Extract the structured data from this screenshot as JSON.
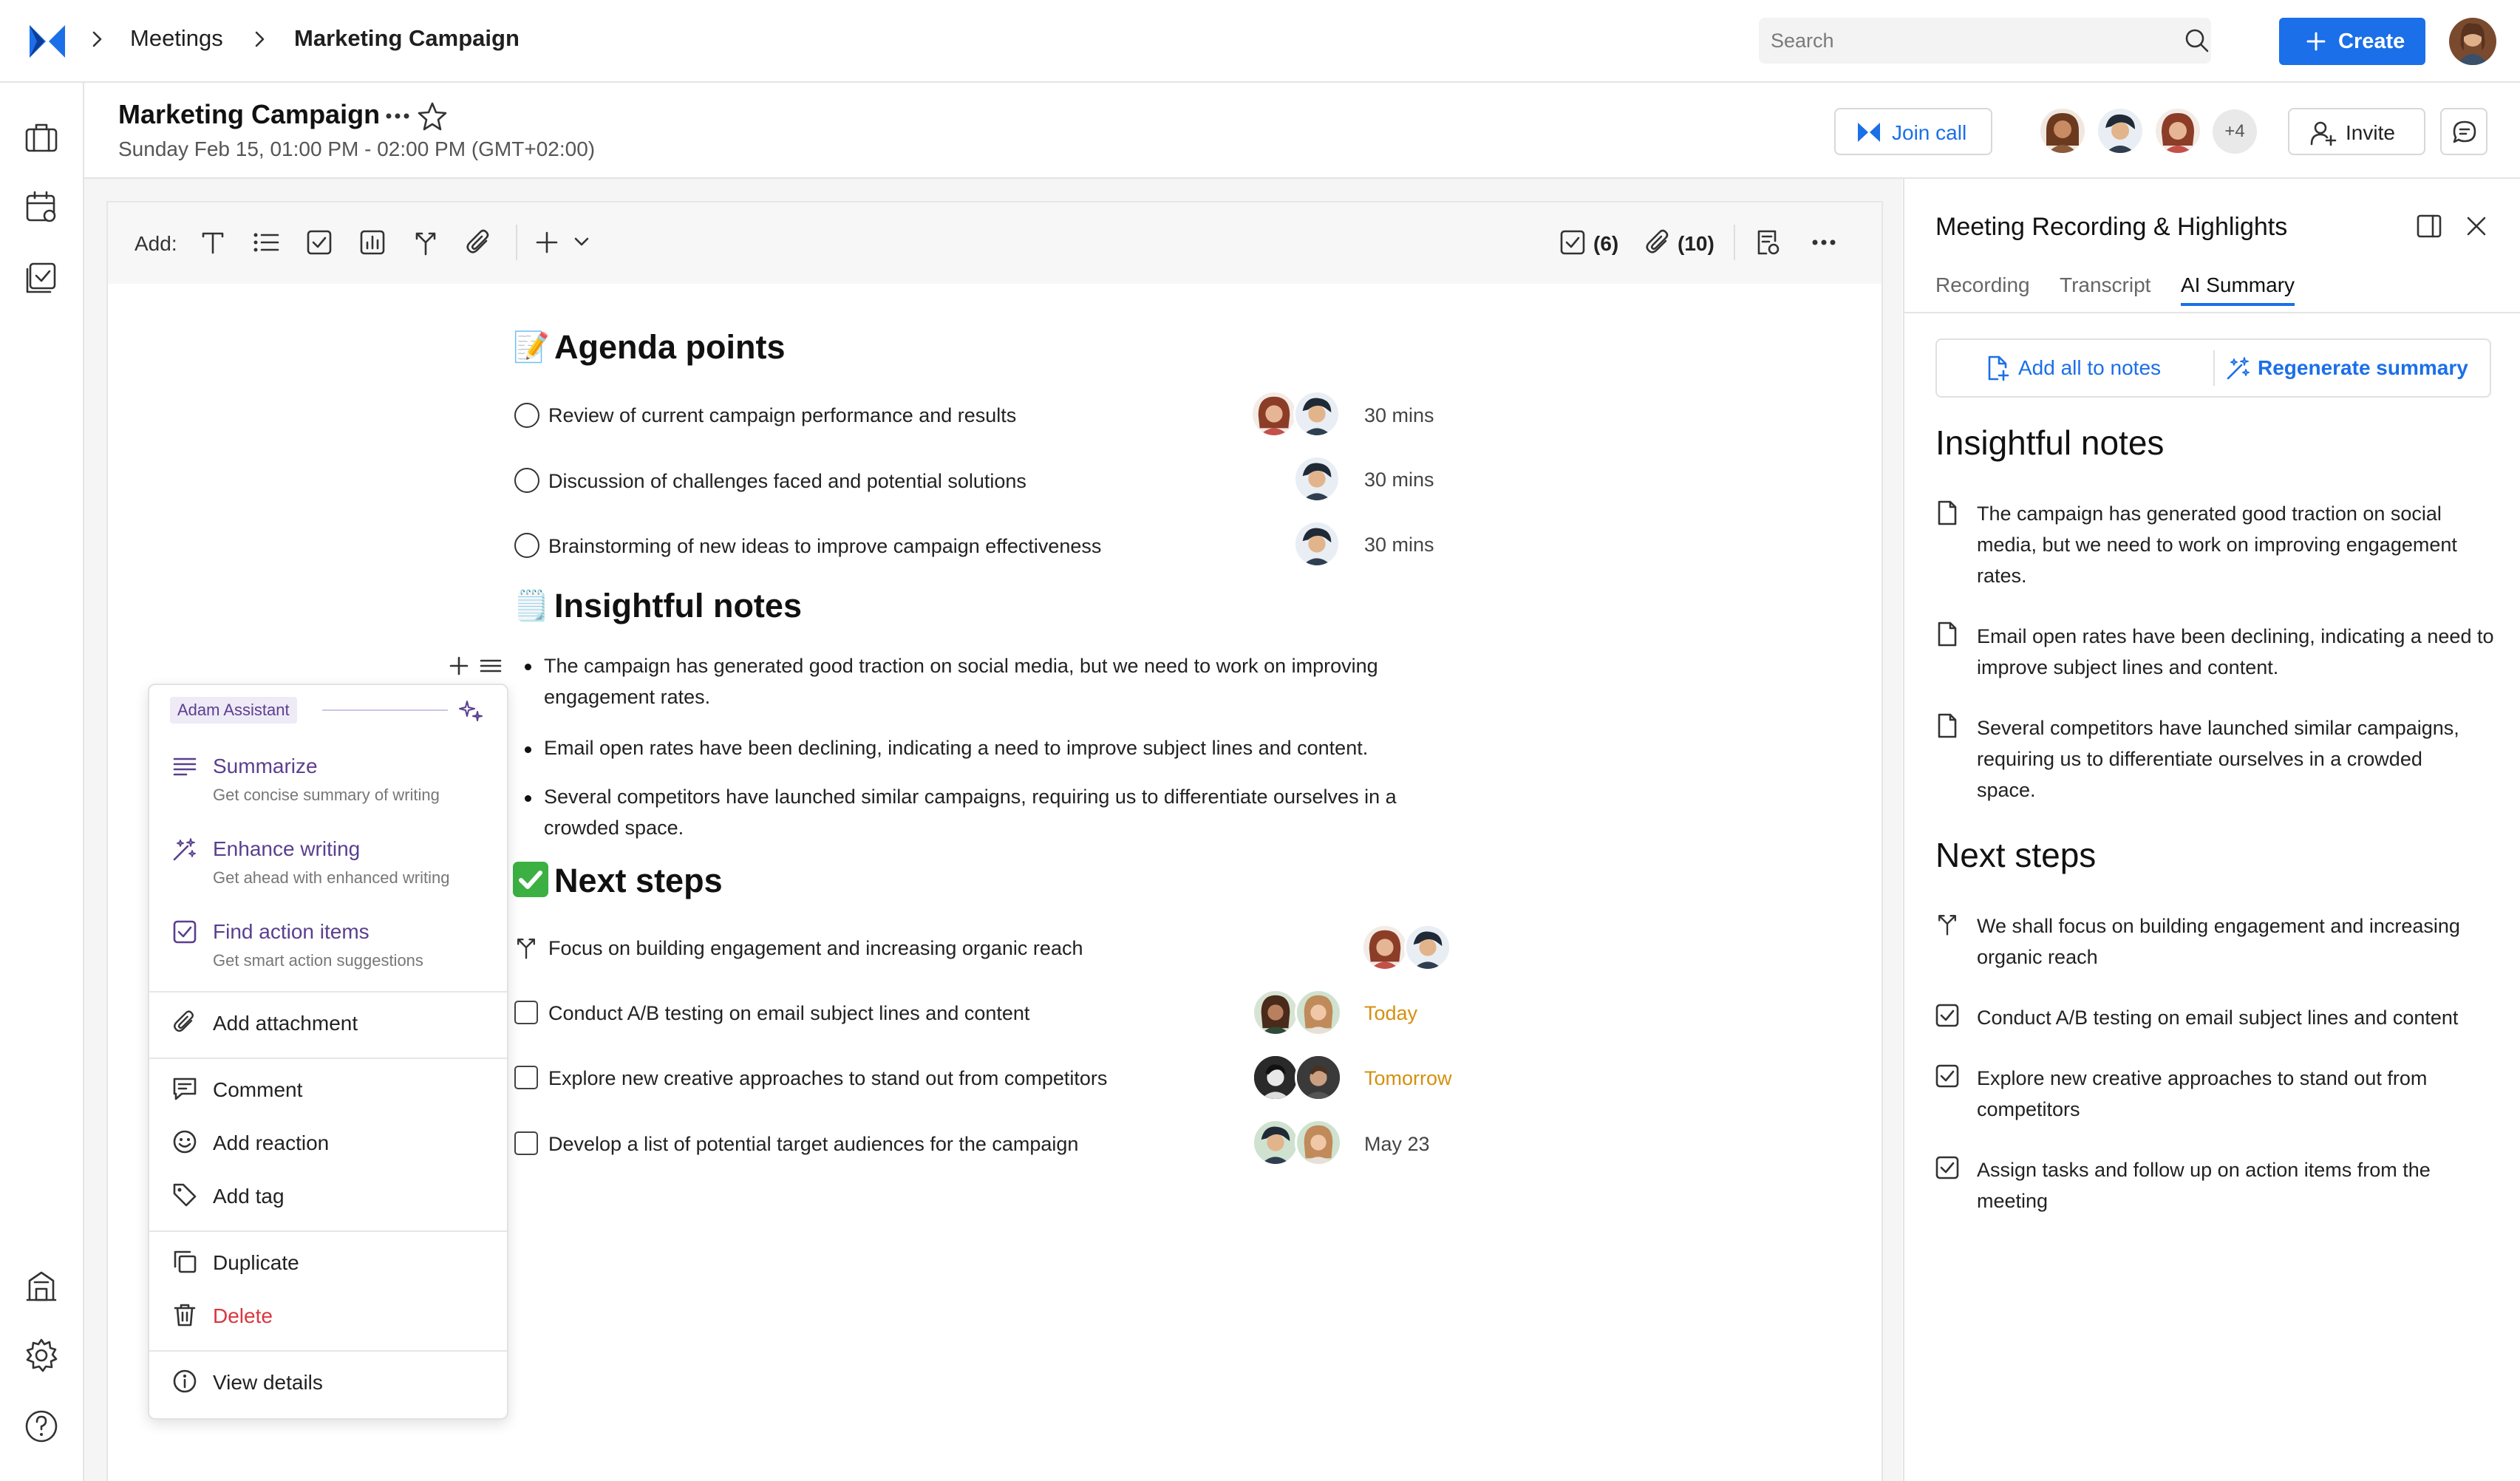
{
  "topbar": {
    "breadcrumb": [
      "Meetings",
      "Marketing Campaign"
    ],
    "search_placeholder": "Search",
    "create_label": "Create"
  },
  "sidebar": {
    "icons": [
      "briefcase-icon",
      "calendar-icon",
      "tasks-icon",
      "building-icon",
      "settings-icon",
      "help-icon"
    ]
  },
  "meeting": {
    "title": "Marketing Campaign",
    "datetime": "Sunday Feb 15, 01:00 PM - 02:00 PM (GMT+02:00)",
    "join_call_label": "Join call",
    "participants_more": "+4",
    "invite_label": "Invite"
  },
  "toolbar": {
    "add_label": "Add:",
    "tasks_count": "(6)",
    "attachments_count": "(10)"
  },
  "editor": {
    "agenda_heading": "Agenda points",
    "agenda_emoji": "📝",
    "agenda": [
      {
        "text": "Review of current campaign performance and results",
        "duration": "30 mins"
      },
      {
        "text": "Discussion of challenges faced and potential solutions",
        "duration": "30 mins"
      },
      {
        "text": "Brainstorming of new ideas to improve campaign effectiveness",
        "duration": "30 mins"
      }
    ],
    "notes_heading": "Insightful notes",
    "notes_emoji": "🗒️",
    "notes": [
      {
        "line1": "The campaign has generated good traction on social media, but we need to work on improving",
        "line2": "engagement rates."
      },
      {
        "line1": "Email open rates have been declining, indicating a need to improve subject lines and content.",
        "line2": ""
      },
      {
        "line1": "Several competitors have launched similar campaigns, requiring us to differentiate ourselves in a",
        "line2": "crowded space."
      }
    ],
    "steps_heading": "Next steps",
    "steps_emoji": "✅",
    "steps": [
      {
        "text": "Focus on building engagement and increasing organic reach",
        "due": "",
        "due_color": "#444444"
      },
      {
        "text": "Conduct A/B testing on email subject lines and content",
        "due": "Today",
        "due_color": "#d4900f"
      },
      {
        "text": "Explore new creative approaches to stand out from competitors",
        "due": "Tomorrow",
        "due_color": "#d4900f"
      },
      {
        "text": "Develop a list of potential target audiences for the campaign",
        "due": "May 23",
        "due_color": "#444444"
      }
    ]
  },
  "context_menu": {
    "assistant_label": "Adam Assistant",
    "summarize": "Summarize",
    "summarize_sub": "Get concise summary of writing",
    "enhance": "Enhance writing",
    "enhance_sub": "Get ahead with enhanced writing",
    "find": "Find action items",
    "find_sub": "Get smart action suggestions",
    "add_attachment": "Add attachment",
    "comment": "Comment",
    "add_reaction": "Add reaction",
    "add_tag": "Add tag",
    "duplicate": "Duplicate",
    "delete": "Delete",
    "view_details": "View details"
  },
  "panel": {
    "title": "Meeting Recording & Highlights",
    "tabs": [
      "Recording",
      "Transcript",
      "AI Summary"
    ],
    "active_tab": "AI Summary",
    "add_all_label": "Add all to notes",
    "regenerate_label": "Regenerate summary",
    "notes_heading": "Insightful notes",
    "notes": [
      [
        "The campaign has generated good traction on social",
        "media, but we need to work on improving engagement",
        "rates."
      ],
      [
        "Email open rates have been declining, indicating a need to",
        "improve subject lines and content."
      ],
      [
        "Several competitors have launched similar campaigns,",
        "requiring us to differentiate ourselves in a crowded",
        "space."
      ]
    ],
    "steps_heading": "Next steps",
    "steps": [
      [
        "We shall focus on building engagement and increasing",
        "organic reach"
      ],
      [
        "Conduct A/B testing on email subject lines and content"
      ],
      [
        "Explore new creative approaches to stand out from",
        "competitors"
      ],
      [
        "Assign tasks and follow up on action items from the",
        "meeting"
      ]
    ]
  },
  "colors": {
    "primary": "#1b6fe8",
    "assistant_purple": "#5a3f8f",
    "delete_red": "#d9363e",
    "due_orange": "#d4900f"
  }
}
